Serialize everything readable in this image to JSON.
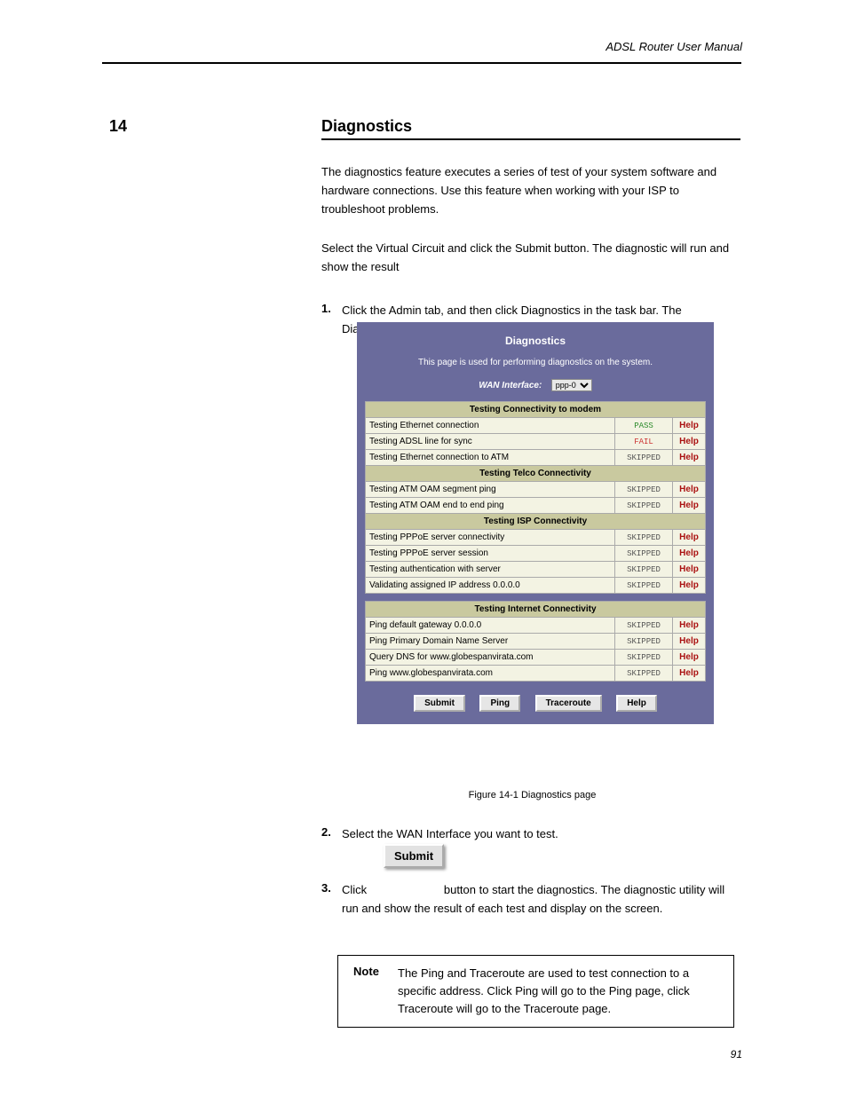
{
  "header_right": "ADSL Router User Manual",
  "section_number": "14",
  "section_title": "Diagnostics",
  "para1": "The diagnostics feature executes a series of test of your system software and hardware connections. Use this feature when working with your ISP to troubleshoot problems.",
  "para2": "Select the Virtual Circuit and click the Submit button. The diagnostic will run and show the result",
  "step1_num": "1.",
  "step1_text": "Click the Admin tab, and then click Diagnostics in the task bar. The Diagnostics page displays?",
  "diag": {
    "title": "Diagnostics",
    "desc": "This page is used for performing diagnostics on the system.",
    "wan_label": "WAN Interface:",
    "wan_value": "ppp-0",
    "help_label": "Help",
    "sections": [
      {
        "header": "Testing Connectivity to modem",
        "rows": [
          {
            "name": "Testing Ethernet connection",
            "status": "PASS",
            "cls": "pass"
          },
          {
            "name": "Testing ADSL line for sync",
            "status": "FAIL",
            "cls": "fail"
          },
          {
            "name": "Testing Ethernet connection to ATM",
            "status": "SKIPPED",
            "cls": "skip"
          }
        ]
      },
      {
        "header": "Testing Telco Connectivity",
        "rows": [
          {
            "name": "Testing ATM OAM segment ping",
            "status": "SKIPPED",
            "cls": "skip"
          },
          {
            "name": "Testing ATM OAM end to end ping",
            "status": "SKIPPED",
            "cls": "skip"
          }
        ]
      },
      {
        "header": "Testing ISP Connectivity",
        "rows": [
          {
            "name": "Testing PPPoE server connectivity",
            "status": "SKIPPED",
            "cls": "skip"
          },
          {
            "name": "Testing PPPoE server session",
            "status": "SKIPPED",
            "cls": "skip"
          },
          {
            "name": "Testing authentication with server",
            "status": "SKIPPED",
            "cls": "skip"
          },
          {
            "name": "Validating assigned IP address 0.0.0.0",
            "status": "SKIPPED",
            "cls": "skip"
          }
        ]
      }
    ],
    "sections2": [
      {
        "header": "Testing Internet Connectivity",
        "rows": [
          {
            "name": "Ping default gateway 0.0.0.0",
            "status": "SKIPPED",
            "cls": "skip"
          },
          {
            "name": "Ping Primary Domain Name Server",
            "status": "SKIPPED",
            "cls": "skip"
          },
          {
            "name": "Query DNS for www.globespanvirata.com",
            "status": "SKIPPED",
            "cls": "skip"
          },
          {
            "name": "Ping www.globespanvirata.com",
            "status": "SKIPPED",
            "cls": "skip"
          }
        ]
      }
    ],
    "buttons": {
      "submit": "Submit",
      "ping": "Ping",
      "traceroute": "Traceroute",
      "help": "Help"
    }
  },
  "fig_caption1": "Figure 14-1 Diagnostics page",
  "step2_num": "2.",
  "step2_text": "Select the WAN Interface you want to test.",
  "submit_big": "Submit",
  "step3_num": "3.",
  "step3_text_a": "Click",
  "step3_text_b": "button to start the diagnostics. The diagnostic utility will run and show the result of each test and display on the screen.",
  "note_label": "Note",
  "note_text": "The Ping and Traceroute are used to test connection to a specific address. Click Ping will go to the Ping page, click Traceroute will go to the Traceroute page.",
  "page_num": "91"
}
